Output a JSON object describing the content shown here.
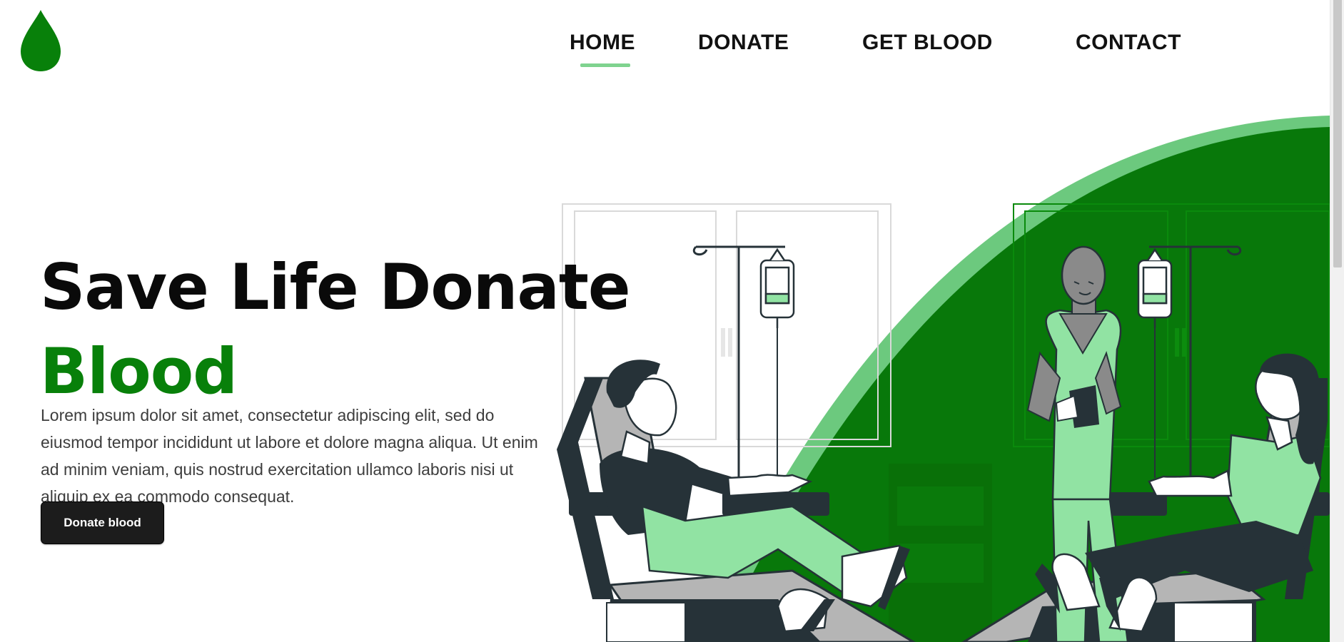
{
  "brand": {
    "logo_icon": "blood-drop-icon",
    "logo_color": "#08800a"
  },
  "nav": {
    "items": [
      {
        "label": "HOME",
        "active": true
      },
      {
        "label": "DONATE"
      },
      {
        "label": "GET BLOOD"
      },
      {
        "label": "CONTACT"
      }
    ],
    "active_color": "#7fd38f"
  },
  "hero": {
    "title_line1": "Save Life Donate",
    "title_line2": "Blood",
    "paragraph": "Lorem ipsum dolor sit amet, consectetur adipiscing elit, sed do eiusmod tempor incididunt ut labore et dolore magna aliqua. Ut enim ad minim veniam, quis nostrud exercitation ullamco laboris nisi ut aliquip ex ea commodo consequat.",
    "cta_label": "Donate blood"
  },
  "illustration": {
    "name": "blood-donation-illustration",
    "colors": {
      "primary": "#08780a",
      "light": "#91e3a3",
      "arc": "#6cc97e",
      "dark": "#263238",
      "chair": "#b5b5b5"
    }
  }
}
